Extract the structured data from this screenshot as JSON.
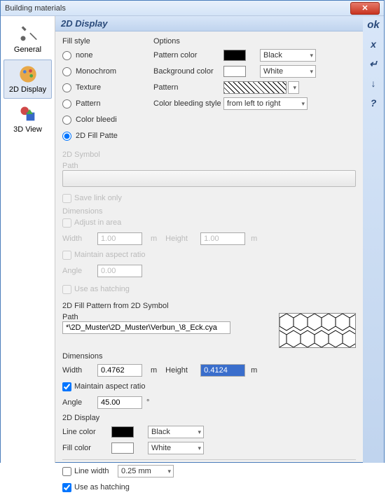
{
  "window": {
    "title": "Building materials"
  },
  "rightbar": {
    "ok": "ok",
    "cancel": "x",
    "b1": "↵",
    "b2": "↓",
    "help": "?"
  },
  "sidebar": {
    "items": [
      {
        "label": "General"
      },
      {
        "label": "2D Display"
      },
      {
        "label": "3D View"
      }
    ]
  },
  "header": {
    "title": "2D Display"
  },
  "fillstyle": {
    "title": "Fill style",
    "opts": [
      "none",
      "Monochrom",
      "Texture",
      "Pattern",
      "Color bleedi",
      "2D Fill Patte"
    ],
    "selected": 5
  },
  "options": {
    "title": "Options",
    "pattern_color_lbl": "Pattern color",
    "pattern_color_val": "Black",
    "bg_color_lbl": "Background color",
    "bg_color_val": "White",
    "pattern_lbl": "Pattern",
    "bleed_lbl": "Color bleeding style",
    "bleed_val": "from left to right"
  },
  "symbol2d": {
    "title": "2D Symbol",
    "path_lbl": "Path",
    "savelink": "Save link only",
    "dims": "Dimensions",
    "adjust": "Adjust in area",
    "width_lbl": "Width",
    "width_val": "1.00",
    "m": "m",
    "height_lbl": "Height",
    "height_val": "1.00",
    "aspect": "Maintain aspect ratio",
    "angle_lbl": "Angle",
    "angle_val": "0.00",
    "hatch": "Use as hatching"
  },
  "fillpattern": {
    "title": "2D Fill Pattern from 2D Symbol",
    "path_lbl": "Path",
    "path_val": "*\\2D_Muster\\2D_Muster\\Verbun_\\8_Eck.cya",
    "dims": "Dimensions",
    "width_lbl": "Width",
    "width_val": "0.4762",
    "m": "m",
    "height_lbl": "Height",
    "height_val": "0.4124",
    "aspect": "Maintain aspect ratio",
    "angle_lbl": "Angle",
    "angle_val": "45.00",
    "disp": "2D Display",
    "line_color_lbl": "Line color",
    "line_color_val": "Black",
    "fill_color_lbl": "Fill color",
    "fill_color_val": "White",
    "line_width_lbl": "Line width",
    "line_width_val": "0.25 mm",
    "hatch": "Use as hatching"
  }
}
